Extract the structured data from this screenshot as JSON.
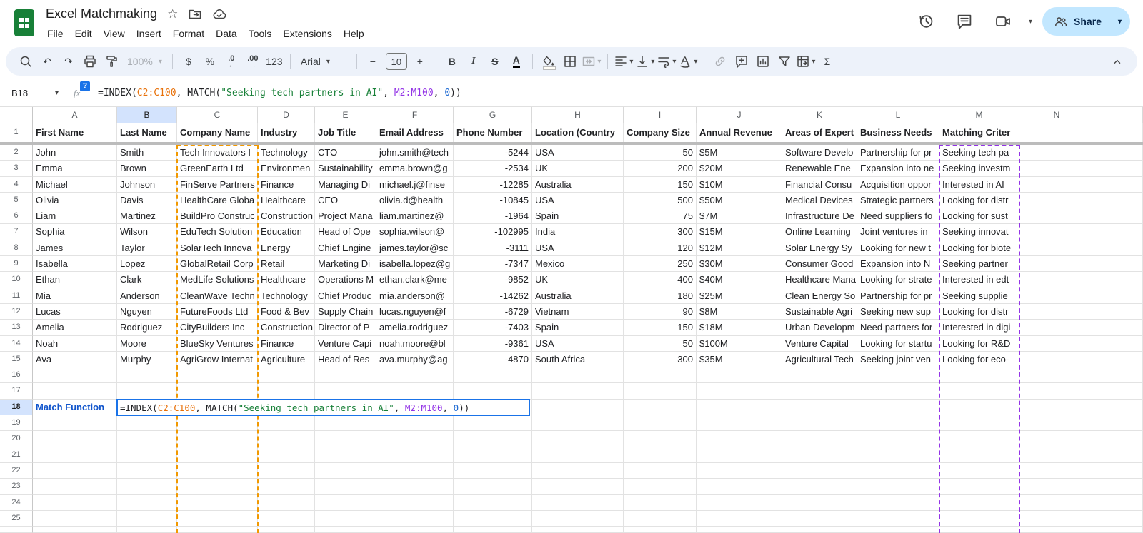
{
  "app": {
    "title": "Excel Matchmaking"
  },
  "titlebar_icons": [
    "star-icon",
    "move-folder-icon",
    "cloud-saved-icon"
  ],
  "menu": {
    "items": [
      "File",
      "Edit",
      "View",
      "Insert",
      "Format",
      "Data",
      "Tools",
      "Extensions",
      "Help"
    ]
  },
  "top_actions": {
    "share_label": "Share",
    "icons": [
      "version-history-icon",
      "comments-icon",
      "video-call-icon"
    ]
  },
  "toolbar": {
    "items": [
      {
        "name": "search",
        "kind": "icon"
      },
      {
        "name": "undo",
        "kind": "glyph",
        "label": "↶"
      },
      {
        "name": "redo",
        "kind": "glyph",
        "label": "↷"
      },
      {
        "name": "print",
        "kind": "icon"
      },
      {
        "name": "paint-format",
        "kind": "icon"
      },
      {
        "name": "zoom",
        "kind": "select",
        "label": "100%",
        "disabled": true
      },
      {
        "kind": "divider"
      },
      {
        "name": "format-currency",
        "kind": "glyph",
        "label": "$"
      },
      {
        "name": "format-percent",
        "kind": "glyph",
        "label": "%"
      },
      {
        "name": "decrease-decimals",
        "kind": "stack",
        "label": ".0",
        "arrow": "←"
      },
      {
        "name": "increase-decimals",
        "kind": "stack",
        "label": ".00",
        "arrow": "→"
      },
      {
        "name": "more-formats",
        "kind": "glyph",
        "label": "123"
      },
      {
        "kind": "divider"
      },
      {
        "name": "font",
        "kind": "select",
        "label": "Arial",
        "wide": true
      },
      {
        "kind": "divider"
      },
      {
        "name": "decrease-font-size",
        "kind": "glyph",
        "label": "−"
      },
      {
        "name": "font-size",
        "kind": "box",
        "label": "10"
      },
      {
        "name": "increase-font-size",
        "kind": "glyph",
        "label": "+"
      },
      {
        "kind": "divider"
      },
      {
        "name": "bold",
        "kind": "glyph",
        "label": "B",
        "cls": "b"
      },
      {
        "name": "italic",
        "kind": "glyph",
        "label": "I",
        "cls": "i"
      },
      {
        "name": "strikethrough",
        "kind": "glyph",
        "label": "S",
        "cls": "s"
      },
      {
        "name": "text-color",
        "kind": "glyph",
        "label": "A",
        "cls": "tc"
      },
      {
        "kind": "divider"
      },
      {
        "name": "fill-color",
        "kind": "icon",
        "cls": "fc"
      },
      {
        "name": "borders",
        "kind": "icon"
      },
      {
        "name": "merge-cells",
        "kind": "icon",
        "caret": true,
        "disabled": true
      },
      {
        "kind": "divider"
      },
      {
        "name": "horizontal-align",
        "kind": "icon",
        "caret": true
      },
      {
        "name": "vertical-align",
        "kind": "icon",
        "caret": true
      },
      {
        "name": "text-wrap",
        "kind": "icon",
        "caret": true
      },
      {
        "name": "text-rotation",
        "kind": "icon",
        "caret": true
      },
      {
        "kind": "divider"
      },
      {
        "name": "insert-link",
        "kind": "icon",
        "disabled": true
      },
      {
        "name": "insert-comment",
        "kind": "icon"
      },
      {
        "name": "insert-chart",
        "kind": "icon"
      },
      {
        "name": "create-filter",
        "kind": "icon"
      },
      {
        "name": "pivot-table",
        "kind": "icon",
        "caret": true
      },
      {
        "name": "functions",
        "kind": "glyph",
        "label": "Σ"
      }
    ]
  },
  "formula_bar": {
    "cell_ref": "B18",
    "fx_label": "fx",
    "help_badge": "?",
    "formula_segments": [
      {
        "text": "=INDEX(",
        "color": "#202124"
      },
      {
        "text": "C2:C100",
        "color": "#e8710a"
      },
      {
        "text": ", MATCH(",
        "color": "#202124"
      },
      {
        "text": "\"Seeking tech partners in AI\"",
        "color": "#188038"
      },
      {
        "text": ", ",
        "color": "#202124"
      },
      {
        "text": "M2:M100",
        "color": "#9334e6"
      },
      {
        "text": ", ",
        "color": "#202124"
      },
      {
        "text": "0",
        "color": "#1967d2"
      },
      {
        "text": "))",
        "color": "#202124"
      }
    ]
  },
  "grid": {
    "col_letters": [
      "A",
      "B",
      "C",
      "D",
      "E",
      "F",
      "G",
      "H",
      "I",
      "J",
      "K",
      "L",
      "M",
      "N"
    ],
    "active_col": "B",
    "active_row": "18",
    "header_cells": [
      "First Name",
      "Last Name",
      "Company Name",
      "Industry",
      "Job Title",
      "Email Address",
      "Phone Number",
      "Location (Country",
      "Company Size",
      "Annual Revenue",
      "Areas of Expert",
      "Business Needs",
      "Matching Criter",
      ""
    ],
    "data_rows": [
      {
        "n": "2",
        "cells": [
          "John",
          "Smith",
          "Tech Innovators I",
          "Technology",
          "CTO",
          "john.smith@tech",
          "-5244",
          "USA",
          "50",
          "$5M",
          "Software Develo",
          "Partnership for pr",
          "Seeking tech pa",
          ""
        ]
      },
      {
        "n": "3",
        "cells": [
          "Emma",
          "Brown",
          "GreenEarth Ltd",
          "Environmen",
          "Sustainability",
          "emma.brown@g",
          "-2534",
          "UK",
          "200",
          "$20M",
          "Renewable Ene",
          "Expansion into ne",
          "Seeking investm",
          ""
        ]
      },
      {
        "n": "4",
        "cells": [
          "Michael",
          "Johnson",
          "FinServe Partners",
          "Finance",
          "Managing Di",
          "michael.j@finse",
          "-12285",
          "Australia",
          "150",
          "$10M",
          "Financial Consu",
          "Acquisition oppor",
          "Interested in AI",
          ""
        ]
      },
      {
        "n": "5",
        "cells": [
          "Olivia",
          "Davis",
          "HealthCare Globa",
          "Healthcare",
          "CEO",
          "olivia.d@health",
          "-10845",
          "USA",
          "500",
          "$50M",
          "Medical Devices",
          "Strategic partners",
          "Looking for distr",
          ""
        ]
      },
      {
        "n": "6",
        "cells": [
          "Liam",
          "Martinez",
          "BuildPro Construc",
          "Construction",
          "Project Mana",
          "liam.martinez@",
          "-1964",
          "Spain",
          "75",
          "$7M",
          "Infrastructure De",
          "Need suppliers fo",
          "Looking for sust",
          ""
        ]
      },
      {
        "n": "7",
        "cells": [
          "Sophia",
          "Wilson",
          "EduTech Solution",
          "Education",
          "Head of Ope",
          "sophia.wilson@",
          "-102995",
          "India",
          "300",
          "$15M",
          "Online Learning",
          "Joint ventures in",
          "Seeking innovat",
          ""
        ]
      },
      {
        "n": "8",
        "cells": [
          "James",
          "Taylor",
          "SolarTech Innova",
          "Energy",
          "Chief Engine",
          "james.taylor@sc",
          "-3111",
          "USA",
          "120",
          "$12M",
          "Solar Energy Sy",
          "Looking for new t",
          "Looking for biote",
          ""
        ]
      },
      {
        "n": "9",
        "cells": [
          "Isabella",
          "Lopez",
          "GlobalRetail Corp",
          "Retail",
          "Marketing Di",
          "isabella.lopez@g",
          "-7347",
          "Mexico",
          "250",
          "$30M",
          "Consumer Good",
          "Expansion into N",
          "Seeking partner",
          ""
        ]
      },
      {
        "n": "10",
        "cells": [
          "Ethan",
          "Clark",
          "MedLife Solutions",
          "Healthcare",
          "Operations M",
          "ethan.clark@me",
          "-9852",
          "UK",
          "400",
          "$40M",
          "Healthcare Mana",
          "Looking for strate",
          "Interested in edt",
          ""
        ]
      },
      {
        "n": "11",
        "cells": [
          "Mia",
          "Anderson",
          "CleanWave Techn",
          "Technology",
          "Chief Produc",
          "mia.anderson@",
          "-14262",
          "Australia",
          "180",
          "$25M",
          "Clean Energy So",
          "Partnership for pr",
          "Seeking supplie",
          ""
        ]
      },
      {
        "n": "12",
        "cells": [
          "Lucas",
          "Nguyen",
          "FutureFoods Ltd",
          "Food & Bev",
          "Supply Chain",
          "lucas.nguyen@f",
          "-6729",
          "Vietnam",
          "90",
          "$8M",
          "Sustainable Agri",
          "Seeking new sup",
          "Looking for distr",
          ""
        ]
      },
      {
        "n": "13",
        "cells": [
          "Amelia",
          "Rodriguez",
          "CityBuilders Inc",
          "Construction",
          "Director of P",
          "amelia.rodriguez",
          "-7403",
          "Spain",
          "150",
          "$18M",
          "Urban Developm",
          "Need partners for",
          "Interested in digi",
          ""
        ]
      },
      {
        "n": "14",
        "cells": [
          "Noah",
          "Moore",
          "BlueSky Ventures",
          "Finance",
          "Venture Capi",
          "noah.moore@bl",
          "-9361",
          "USA",
          "50",
          "$100M",
          "Venture Capital",
          "Looking for startu",
          "Looking for R&D",
          ""
        ]
      },
      {
        "n": "15",
        "cells": [
          "Ava",
          "Murphy",
          "AgriGrow Internat",
          "Agriculture",
          "Head of Res",
          "ava.murphy@ag",
          "-4870",
          "South Africa",
          "300",
          "$35M",
          "Agricultural Tech",
          "Seeking joint ven",
          "Looking for eco-",
          ""
        ]
      }
    ],
    "row18_label": "Match Function",
    "range_highlights": [
      {
        "range": "C2:C100",
        "color": "#f29900"
      },
      {
        "range": "M2:M100",
        "color": "#9334e6"
      }
    ]
  },
  "colors": {
    "accent_blue": "#1a73e8",
    "active_fill": "#d3e3fd",
    "share_bg": "#c2e7ff",
    "range1_orange": "#f29900",
    "range2_purple": "#9334e6",
    "string_green": "#188038",
    "ref_orange": "#e8710a",
    "number_blue": "#1967d2",
    "label_blue": "#1155cc"
  }
}
